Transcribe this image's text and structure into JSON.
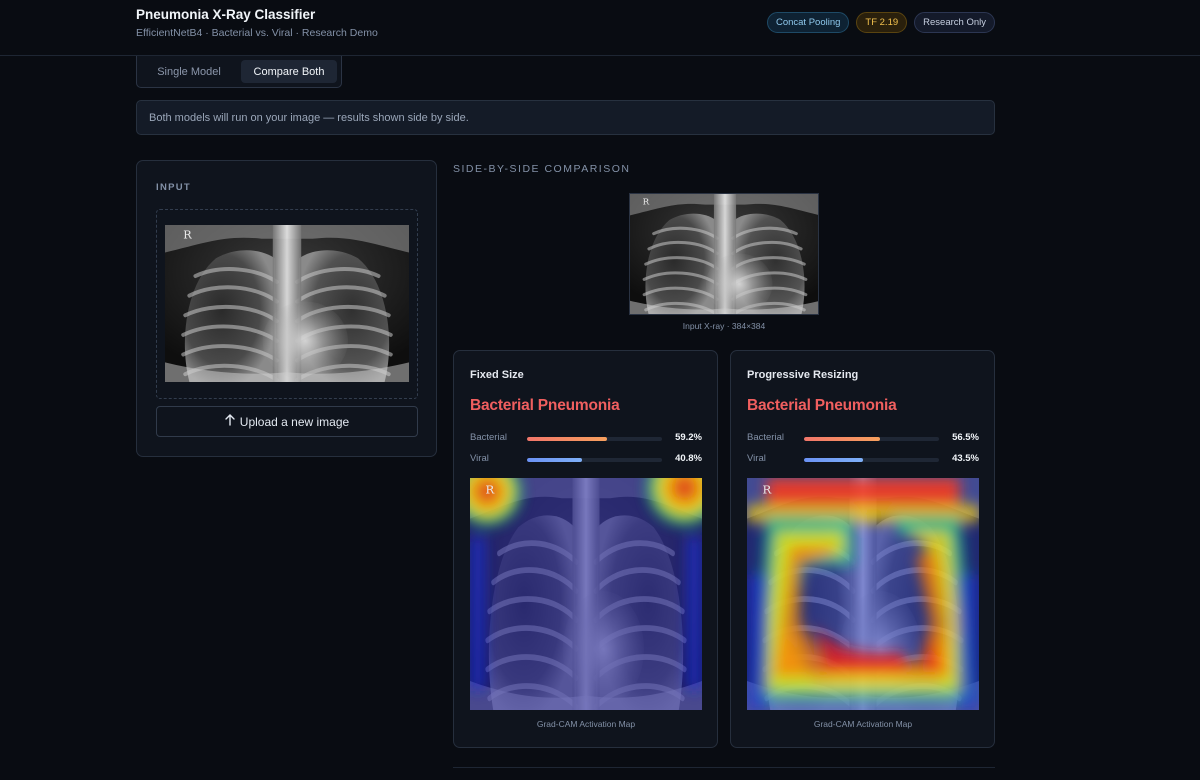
{
  "header": {
    "title": "Pneumonia X-Ray Classifier",
    "subtitle": "EfficientNetB4 · Bacterial vs. Viral · Research Demo",
    "badges": [
      {
        "label": "Concat Pooling",
        "color": "#8fc8ec"
      },
      {
        "label": "TF 2.19",
        "color": "#f2c14e"
      },
      {
        "label": "Research Only",
        "color": "#c6cfe0"
      }
    ]
  },
  "mode": {
    "options": [
      "Single Model",
      "Compare Both"
    ],
    "selected": "Compare Both"
  },
  "info": {
    "text": "Both models will run on your image — results shown side by side."
  },
  "input": {
    "label": "INPUT",
    "marker": "R",
    "upload": {
      "icon": "arrow-up-icon",
      "label": "Upload a new image"
    }
  },
  "comparison": {
    "label": "SIDE-BY-SIDE COMPARISON",
    "preview_caption": "Input X-ray · 384×384",
    "marker": "R"
  },
  "models": [
    {
      "title": "Fixed Size",
      "prediction": "Bacterial Pneumonia",
      "probs": [
        {
          "label": "Bacterial",
          "value": "59.2%",
          "fraction": 0.592,
          "color": "#f4846a"
        },
        {
          "label": "Viral",
          "value": "40.8%",
          "fraction": 0.408,
          "color": "#6e9df7"
        }
      ],
      "cam_caption": "Grad-CAM Activation Map",
      "marker": "R"
    },
    {
      "title": "Progressive Resizing",
      "prediction": "Bacterial Pneumonia",
      "probs": [
        {
          "label": "Bacterial",
          "value": "56.5%",
          "fraction": 0.565,
          "color": "#f4846a"
        },
        {
          "label": "Viral",
          "value": "43.5%",
          "fraction": 0.435,
          "color": "#6e9df7"
        }
      ],
      "cam_caption": "Grad-CAM Activation Map",
      "marker": "R"
    }
  ],
  "colors": {
    "accent_prediction": "#f05f5f",
    "background": "#090c12",
    "panel": "#0f141d"
  }
}
